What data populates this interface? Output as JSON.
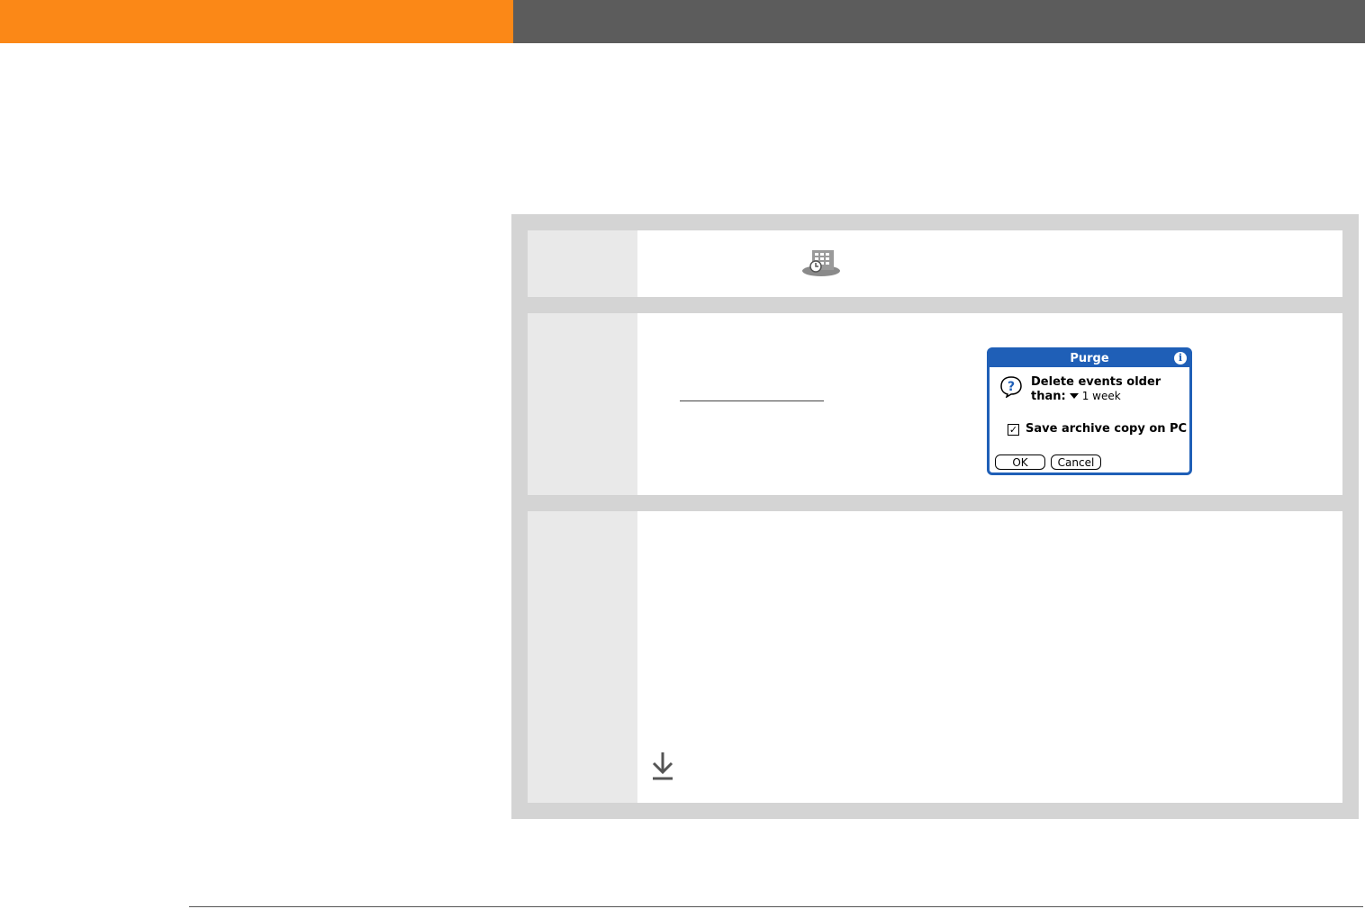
{
  "header": {
    "accent_color": "#fb8817",
    "bar_color": "#5c5c5c"
  },
  "step1": {
    "icon": "calendar-icon"
  },
  "step2": {
    "dialog": {
      "title": "Purge",
      "info_icon": "i",
      "question_icon": "question-icon",
      "message_line1": "Delete events older",
      "than_label": "than:",
      "selected_period": "1 week",
      "checkbox_checked": true,
      "checkbox_label": "Save archive copy on PC",
      "ok_label": "OK",
      "cancel_label": "Cancel",
      "accent_color": "#1f5fb7"
    }
  },
  "step3": {
    "icon": "continue-arrow-icon"
  }
}
